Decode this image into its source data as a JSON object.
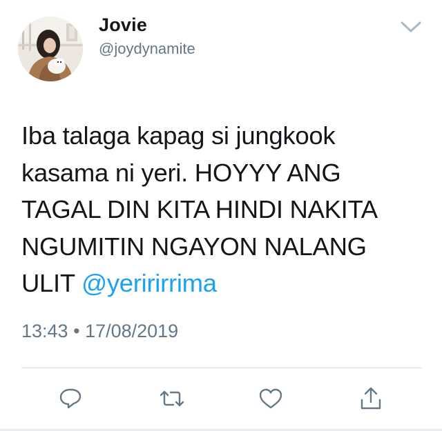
{
  "tweet": {
    "display_name": "Jovie",
    "username": "@joydynamite",
    "text_lines": [
      "Iba talaga kapag si jungkook",
      "kasama ni yeri. HOYYY ANG",
      "TAGAL DIN KITA HINDI NAKITA",
      "NGUMITIN NGAYON NALANG"
    ],
    "text_last_line_prefix": "ULIT ",
    "mention": "@yeririrrima",
    "time": "13:43",
    "separator": "•",
    "date": "17/08/2019"
  },
  "actions": {
    "reply_icon": "reply-icon",
    "retweet_icon": "retweet-icon",
    "like_icon": "heart-icon",
    "share_icon": "share-icon"
  },
  "colors": {
    "text": "#14171a",
    "secondary": "#657786",
    "link": "#1da1f2",
    "divider": "#d7dde2"
  }
}
